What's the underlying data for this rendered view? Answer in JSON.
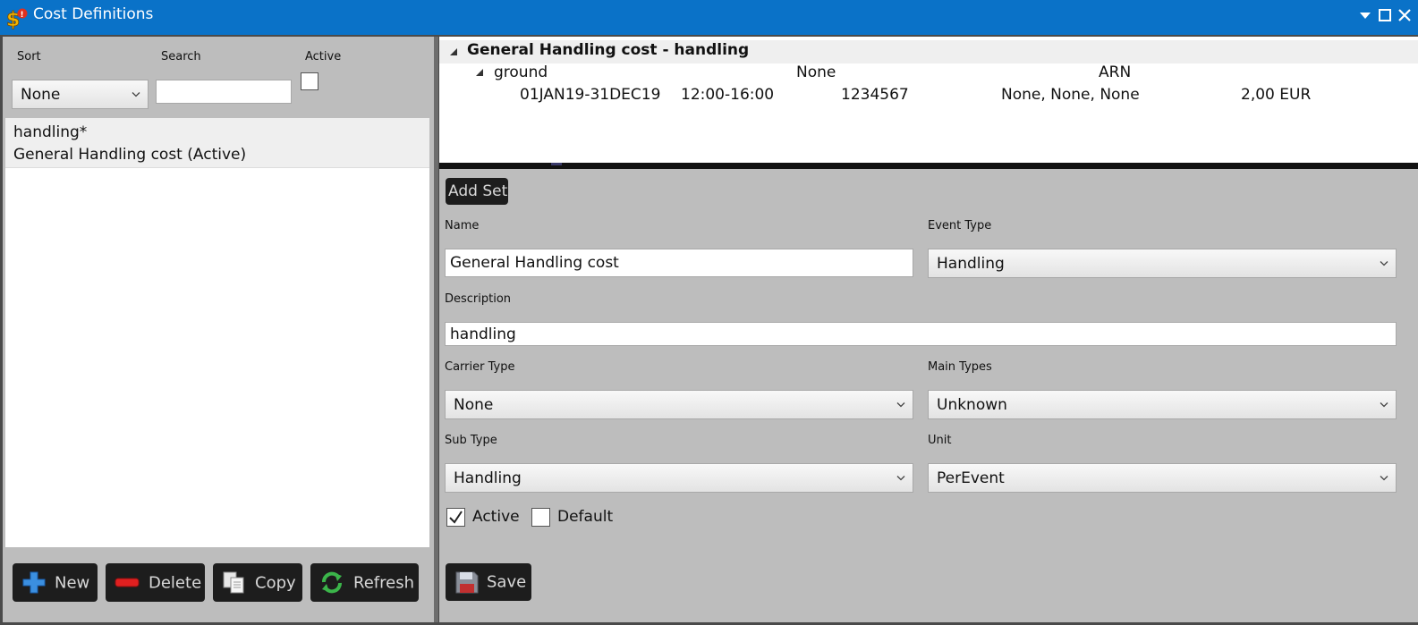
{
  "window": {
    "title": "Cost Definitions",
    "accent": "#0a72c8"
  },
  "filters": {
    "sort_label": "Sort",
    "sort_value": "None",
    "search_label": "Search",
    "search_value": "",
    "active_label": "Active",
    "active_checked": false
  },
  "list": {
    "items": [
      {
        "line1": "handling*",
        "line2": "General Handling cost  (Active)"
      }
    ]
  },
  "buttons": {
    "new": "New",
    "delete": "Delete",
    "copy": "Copy",
    "refresh": "Refresh",
    "add_set": "Add Set",
    "save": "Save"
  },
  "tree": {
    "header": "General Handling cost - handling",
    "group": {
      "name": "ground",
      "value": "None",
      "airport": "ARN"
    },
    "row": {
      "dates": "01JAN19-31DEC19",
      "times": "12:00-16:00",
      "code": "1234567",
      "types": "None, None, None",
      "amount": "2,00 EUR"
    }
  },
  "form": {
    "name_label": "Name",
    "name_value": "General Handling cost",
    "event_type_label": "Event Type",
    "event_type_value": "Handling",
    "description_label": "Description",
    "description_value": "handling",
    "carrier_type_label": "Carrier Type",
    "carrier_type_value": "None",
    "main_types_label": "Main Types",
    "main_types_value": "Unknown",
    "sub_type_label": "Sub Type",
    "sub_type_value": "Handling",
    "unit_label": "Unit",
    "unit_value": "PerEvent",
    "active_label": "Active",
    "active_checked": true,
    "default_label": "Default",
    "default_checked": false
  }
}
